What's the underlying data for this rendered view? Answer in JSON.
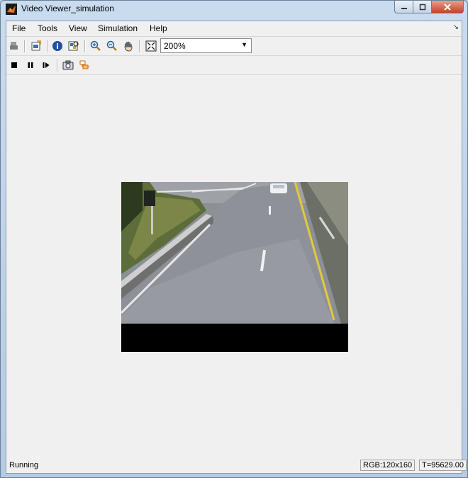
{
  "window": {
    "title": "Video Viewer_simulation"
  },
  "menu": {
    "items": [
      "File",
      "Tools",
      "View",
      "Simulation",
      "Help"
    ]
  },
  "toolbar1": {
    "zoom_value": "200%"
  },
  "status": {
    "text": "Running",
    "format": "RGB:120x160",
    "time": "T=95629.00"
  },
  "colors": {
    "title_bar": "#c9dcef",
    "client_bg": "#f0f0f0",
    "close_button": "#c6412b"
  }
}
